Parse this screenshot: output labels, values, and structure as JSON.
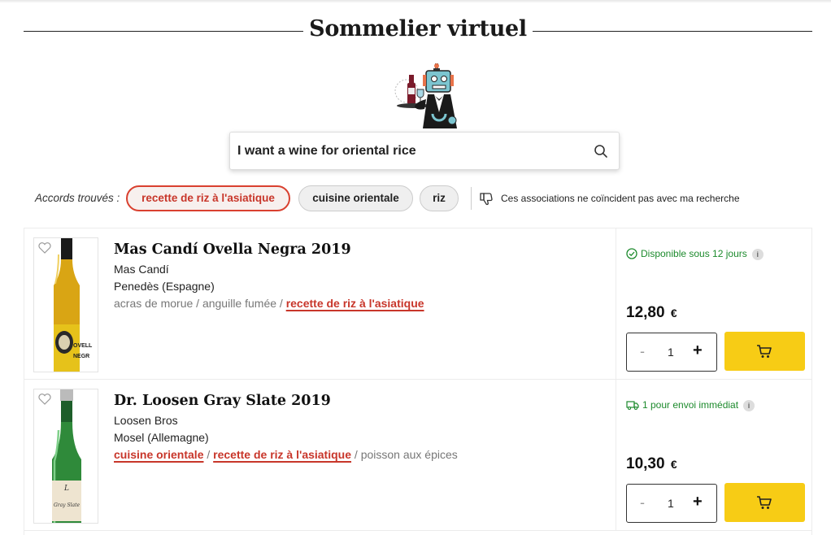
{
  "header": {
    "title": "Sommelier virtuel"
  },
  "search": {
    "value": "I want a wine for oriental rice"
  },
  "matches": {
    "label": "Accords trouvés :",
    "chips": [
      "recette de riz à l'asiatique",
      "cuisine orientale",
      "riz"
    ],
    "dislike_text": "Ces associations ne coïncident pas avec ma recherche"
  },
  "products": [
    {
      "name": "Mas Candí Ovella Negra 2019",
      "producer": "Mas Candí",
      "region": "Penedès (Espagne)",
      "tag1": "acras de morue",
      "sep1": " / ",
      "tag2": "anguille fumée",
      "sep2": " / ",
      "tag3": "recette de riz à l'asiatique",
      "availability": "Disponible sous 12 jours",
      "info": "i",
      "price": "12,80",
      "currency": "€",
      "quantity": "1",
      "minus": "-",
      "plus": "+",
      "label_text1": "OVELL",
      "label_text2": "NEGR",
      "bottle_color": "#d9a514"
    },
    {
      "name": "Dr. Loosen Gray Slate 2019",
      "producer": "Loosen Bros",
      "region": "Mosel (Allemagne)",
      "tag1": "cuisine orientale",
      "sep1": " / ",
      "tag2": "recette de riz à l'asiatique",
      "sep2": " / ",
      "tag3": "poisson aux épices",
      "availability": "1 pour envoi immédiat",
      "info": "i",
      "price": "10,30",
      "currency": "€",
      "quantity": "1",
      "minus": "-",
      "plus": "+",
      "label_text1": "Gray Slate",
      "bottle_color": "#2f8a3a"
    }
  ],
  "colors": {
    "accent_red": "#c8362a",
    "cart_yellow": "#f7cc15",
    "availability_green": "#1c8a2c"
  }
}
